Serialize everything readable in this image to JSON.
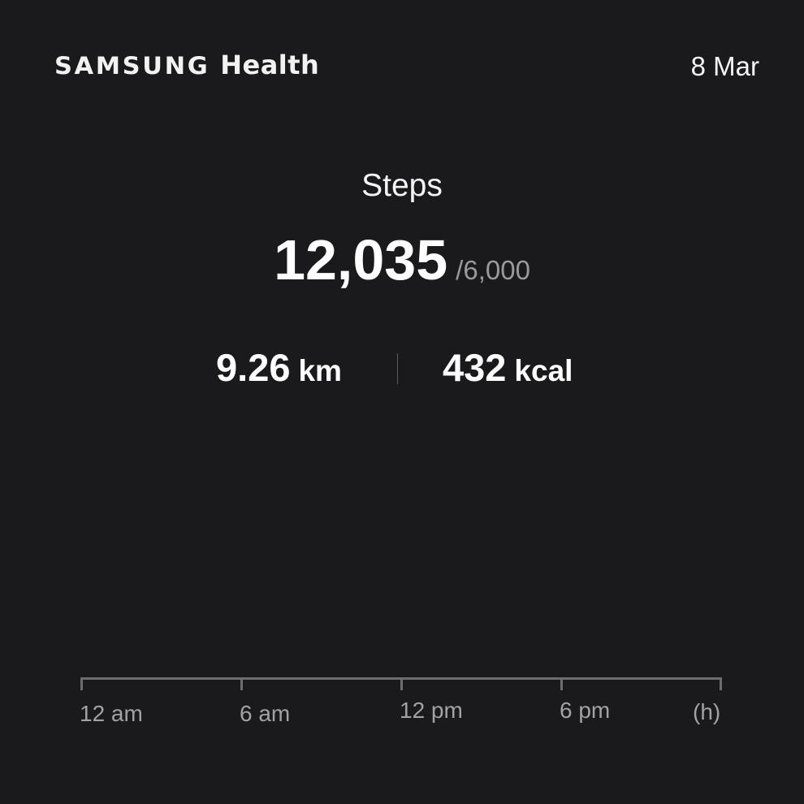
{
  "header": {
    "brand": "SAMSUNG",
    "product": "Health",
    "date": "8 Mar"
  },
  "steps": {
    "title": "Steps",
    "count": "12,035",
    "goal": "/6,000"
  },
  "metrics": {
    "distance_value": "9.26",
    "distance_unit": "km",
    "calories_value": "432",
    "calories_unit": "kcal"
  },
  "chart_data": {
    "type": "bar",
    "categories": [
      "12 am",
      "6 am",
      "12 pm",
      "6 pm"
    ],
    "xlabel": "(h)",
    "values": [],
    "grid": false
  }
}
